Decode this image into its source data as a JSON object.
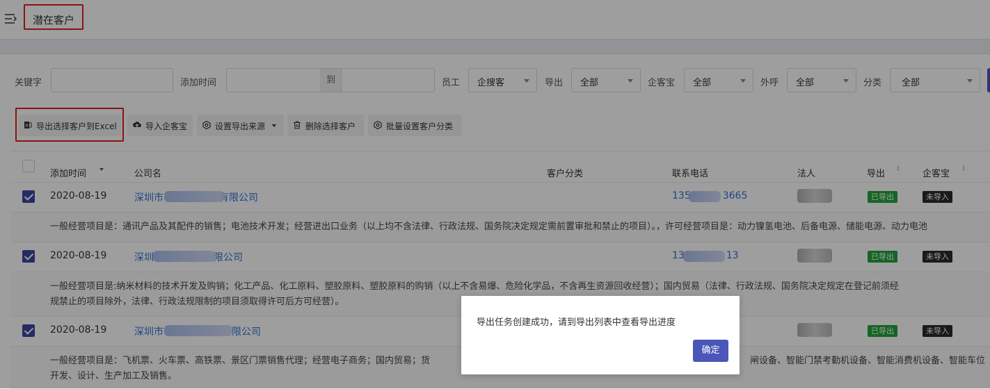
{
  "header": {
    "title": "潜在客户"
  },
  "filters": {
    "keyword_label": "关键字",
    "add_time_label": "添加时间",
    "to_label": "到",
    "employee_label": "员工",
    "employee_value": "企搜客",
    "export_label": "导出",
    "export_value": "全部",
    "qikebao_label": "企客宝",
    "qikebao_value": "全部",
    "waihu_label": "外呼",
    "waihu_value": "全部",
    "category_label": "分类",
    "category_value": "全部"
  },
  "toolbar": {
    "export_excel": "导出选择客户到Excel",
    "import_qikebao": "导入企客宝",
    "set_export_source": "设置导出来源",
    "delete_selected": "删除选择客户",
    "batch_set_category": "批量设置客户分类"
  },
  "table": {
    "columns": {
      "add_time": "添加时间",
      "company": "公司名",
      "customer_category": "客户分类",
      "phone": "联系电话",
      "legal_person": "法人",
      "exported": "导出",
      "qikebao": "企客宝"
    },
    "rows": [
      {
        "date": "2020-08-19",
        "company_prefix": "深圳市",
        "company_suffix": "有限公司",
        "phone_prefix": "135",
        "phone_suffix": "3665",
        "exported": "已导出",
        "qikebao": "未导入",
        "desc_line1": "一般经营项目是：通讯产品及其配件的销售；电池技术开发；经营进出口业务（以上均不含法律、行政法规、国务院决定规定需前置审批和禁止的项目）。，许可经营项目是：动力镍氢电池、后备电源、储能电源、动力电池",
        "desc_line2": ""
      },
      {
        "date": "2020-08-19",
        "company_prefix": "深圳",
        "company_suffix": "限公司",
        "phone_prefix": "13",
        "phone_suffix": "13",
        "exported": "已导出",
        "qikebao": "未导入",
        "desc_line1": "一般经营项目是:纳米材料的技术开发及购销；化工产品、化工原料、塑胶原料、塑胶原料的购销（以上不含易爆、危险化学品，不含再生资源回收经营）；国内贸易（法律、行政法规、国务院决定规定在登记前须经",
        "desc_line2": "规禁止的项目除外，法律、行政法规限制的项目须取得许可后方可经营）。"
      },
      {
        "date": "2020-08-19",
        "company_prefix": "深圳市",
        "company_suffix": "限公司",
        "phone_prefix": "",
        "phone_suffix": "",
        "exported": "已导出",
        "qikebao": "未导入",
        "desc_line1": "一般经营项目是：飞机票、火车票、高铁票、景区门票销售代理；经营电子商务；国内贸易；货",
        "desc_line1_tail": "闸设备、智能门禁考勤机设备、智能消费机设备、智能车位",
        "desc_line2": "开发、设计、生产加工及销售。"
      }
    ]
  },
  "dialog": {
    "message": "导出任务创建成功，请到导出列表中查看导出进度",
    "confirm": "确定"
  }
}
